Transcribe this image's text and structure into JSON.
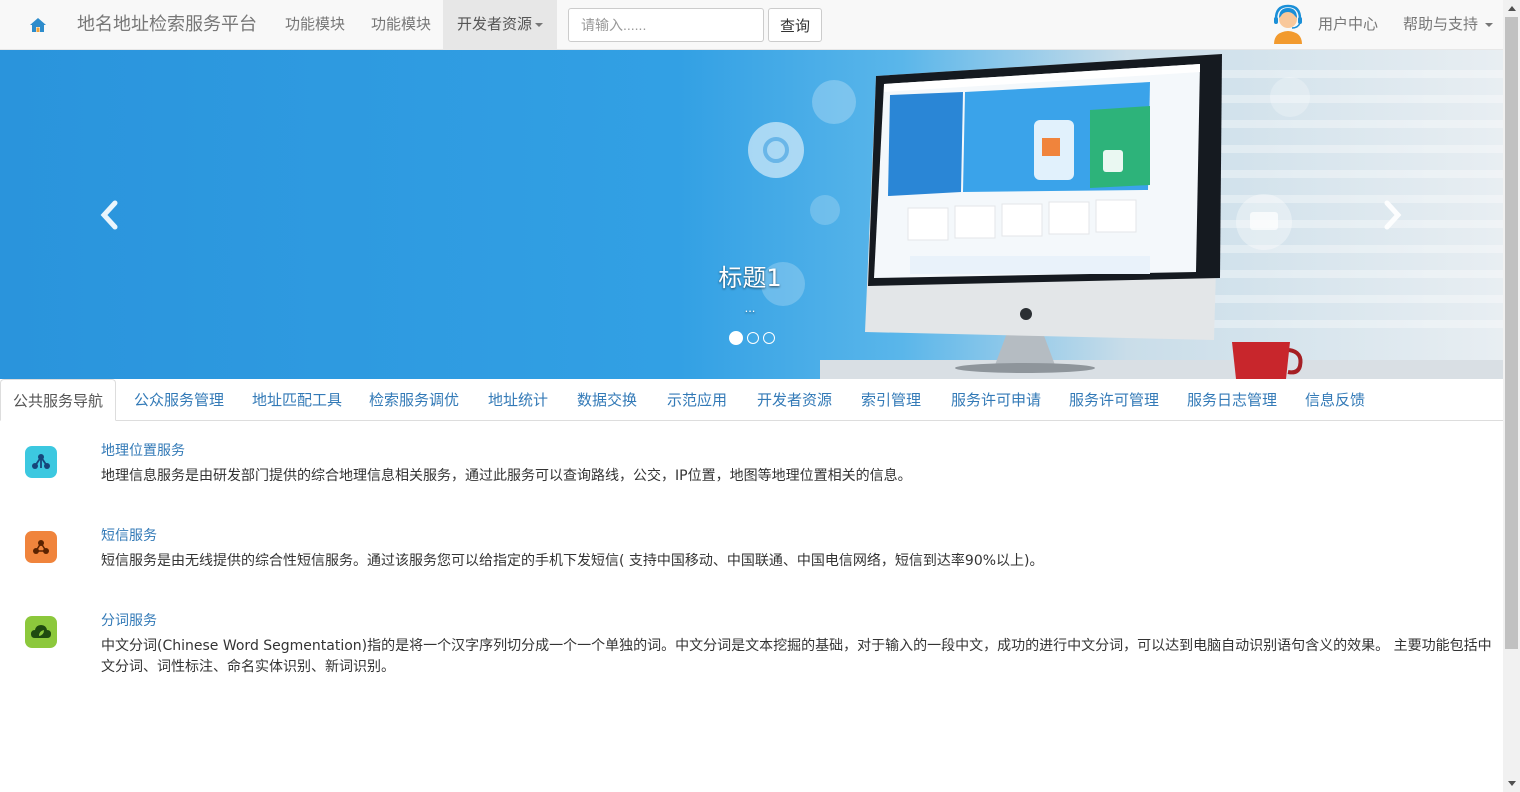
{
  "navbar": {
    "brand": "地名地址检索服务平台",
    "items": [
      {
        "label": "功能模块"
      },
      {
        "label": "功能模块"
      },
      {
        "label": "开发者资源"
      }
    ],
    "search": {
      "placeholder": "请输入......",
      "button": "查询"
    },
    "user_center": "用户中心",
    "help": "帮助与支持"
  },
  "carousel": {
    "caption_title": "标题1",
    "caption_sub": "...",
    "slide_count": 3,
    "active_slide": 1
  },
  "tabs": [
    {
      "label": "公共服务导航",
      "active": true
    },
    {
      "label": "公众服务管理"
    },
    {
      "label": "地址匹配工具"
    },
    {
      "label": "检索服务调优"
    },
    {
      "label": "地址统计"
    },
    {
      "label": "数据交换"
    },
    {
      "label": "示范应用"
    },
    {
      "label": "开发者资源"
    },
    {
      "label": "索引管理"
    },
    {
      "label": "服务许可申请"
    },
    {
      "label": "服务许可管理"
    },
    {
      "label": "服务日志管理"
    },
    {
      "label": "信息反馈"
    }
  ],
  "services": [
    {
      "title": "地理位置服务",
      "desc": "地理信息服务是由研发部门提供的综合地理信息相关服务，通过此服务可以查询路线，公交，IP位置，地图等地理位置相关的信息。",
      "icon": "share-nodes-icon",
      "color": "#3cc8e0"
    },
    {
      "title": "短信服务",
      "desc": "短信服务是由无线提供的综合性短信服务。通过该服务您可以给指定的手机下发短信( 支持中国移动、中国联通、中国电信网络，短信到达率90%以上)。",
      "icon": "molecule-icon",
      "color": "#f0843c"
    },
    {
      "title": "分词服务",
      "desc": "中文分词(Chinese Word Segmentation)指的是将一个汉字序列切分成一个一个单独的词。中文分词是文本挖掘的基础，对于输入的一段中文，成功的进行中文分词，可以达到电脑自动识别语句含义的效果。 主要功能包括中文分词、词性标注、命名实体识别、新词识别。",
      "icon": "cloud-leaf-icon",
      "color": "#8cc83c"
    }
  ]
}
